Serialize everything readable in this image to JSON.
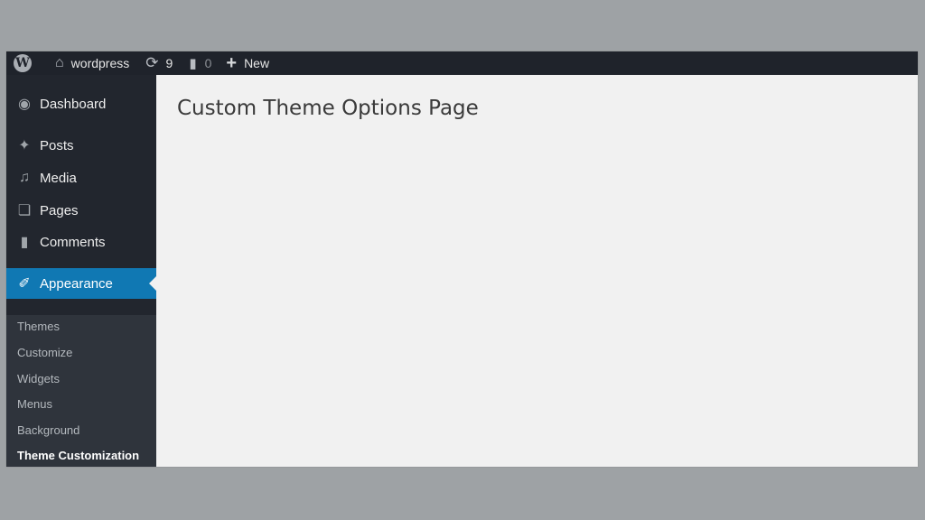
{
  "adminbar": {
    "logo_icon": "wordpress-logo-icon",
    "site_name": "wordpress",
    "updates_count": "9",
    "comments_count": "0",
    "new_label": "New"
  },
  "sidebar": {
    "items": [
      {
        "label": "Dashboard",
        "icon": "dashboard-icon"
      },
      {
        "label": "Posts",
        "icon": "pin-icon"
      },
      {
        "label": "Media",
        "icon": "media-icon"
      },
      {
        "label": "Pages",
        "icon": "pages-icon"
      },
      {
        "label": "Comments",
        "icon": "comment-icon"
      },
      {
        "label": "Appearance",
        "icon": "paintbrush-icon",
        "active": true
      }
    ],
    "submenu": [
      {
        "label": "Themes"
      },
      {
        "label": "Customize"
      },
      {
        "label": "Widgets"
      },
      {
        "label": "Menus"
      },
      {
        "label": "Background"
      },
      {
        "label": "Theme Customization",
        "current": true
      }
    ]
  },
  "main": {
    "title": "Custom Theme Options Page"
  },
  "colors": {
    "adminbar_bg": "#1f232b",
    "sidebar_bg": "#22262e",
    "active_bg": "#1078b3",
    "content_bg": "#f1f1f1"
  }
}
